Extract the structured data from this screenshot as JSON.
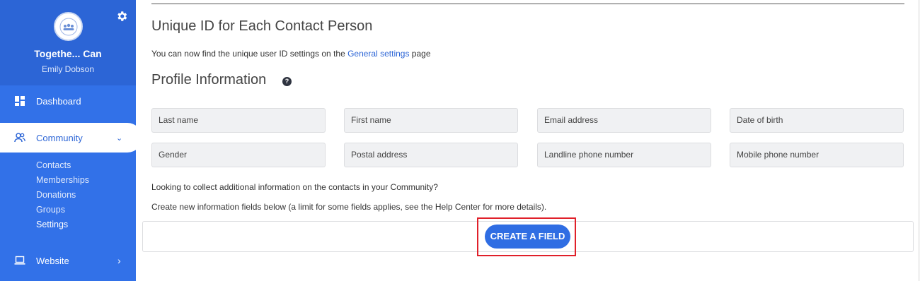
{
  "sidebar": {
    "org_name": "Togethe... Can",
    "user_name": "Emily Dobson",
    "nav": {
      "dashboard": "Dashboard",
      "community": "Community",
      "website": "Website"
    },
    "subnav": [
      "Contacts",
      "Memberships",
      "Donations",
      "Groups",
      "Settings"
    ],
    "active_subnav": "Settings",
    "colors": {
      "sidebar_bg": "#3271e8",
      "header_bg": "#2c65d6",
      "active_text": "#2c65d6"
    }
  },
  "main": {
    "unique_id_heading": "Unique ID for Each Contact Person",
    "unique_id_text_before": "You can now find the unique user ID settings on the ",
    "unique_id_link": "General settings",
    "unique_id_text_after": " page",
    "profile_heading": "Profile Information",
    "help_icon": "question-circle-icon",
    "fields": [
      "Last name",
      "First name",
      "Email address",
      "Date of birth",
      "Gender",
      "Postal address",
      "Landline phone number",
      "Mobile phone number"
    ],
    "extra_text_1": "Looking to collect additional information on the contacts in your Community?",
    "extra_text_2": "Create new information fields below (a limit for some fields applies, see the Help Center for more details).",
    "create_button": "CREATE A FIELD",
    "colors": {
      "button_bg": "#2f6de3",
      "highlight": "#e0202a",
      "link": "#2c65d6"
    }
  }
}
